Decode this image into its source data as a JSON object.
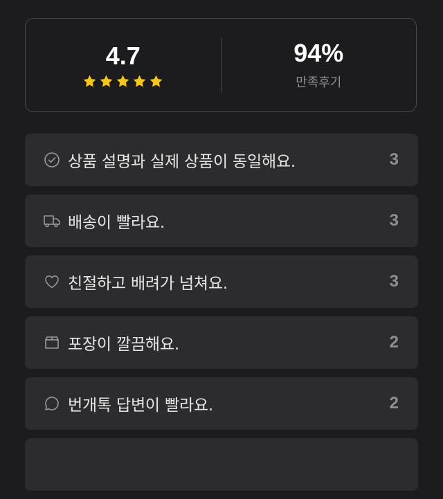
{
  "summary": {
    "rating": "4.7",
    "star_count": 5,
    "star_color": "#f5c518",
    "satisfaction_percent": "94%",
    "satisfaction_label": "만족후기"
  },
  "review_tags": [
    {
      "icon": "check-circle-icon",
      "label": "상품 설명과 실제 상품이 동일해요.",
      "count": "3"
    },
    {
      "icon": "truck-icon",
      "label": "배송이 빨라요.",
      "count": "3"
    },
    {
      "icon": "heart-icon",
      "label": "친절하고 배려가 넘쳐요.",
      "count": "3"
    },
    {
      "icon": "box-icon",
      "label": "포장이 깔끔해요.",
      "count": "2"
    },
    {
      "icon": "chat-bubble-icon",
      "label": "번개톡 답변이 빨라요.",
      "count": "2"
    }
  ]
}
